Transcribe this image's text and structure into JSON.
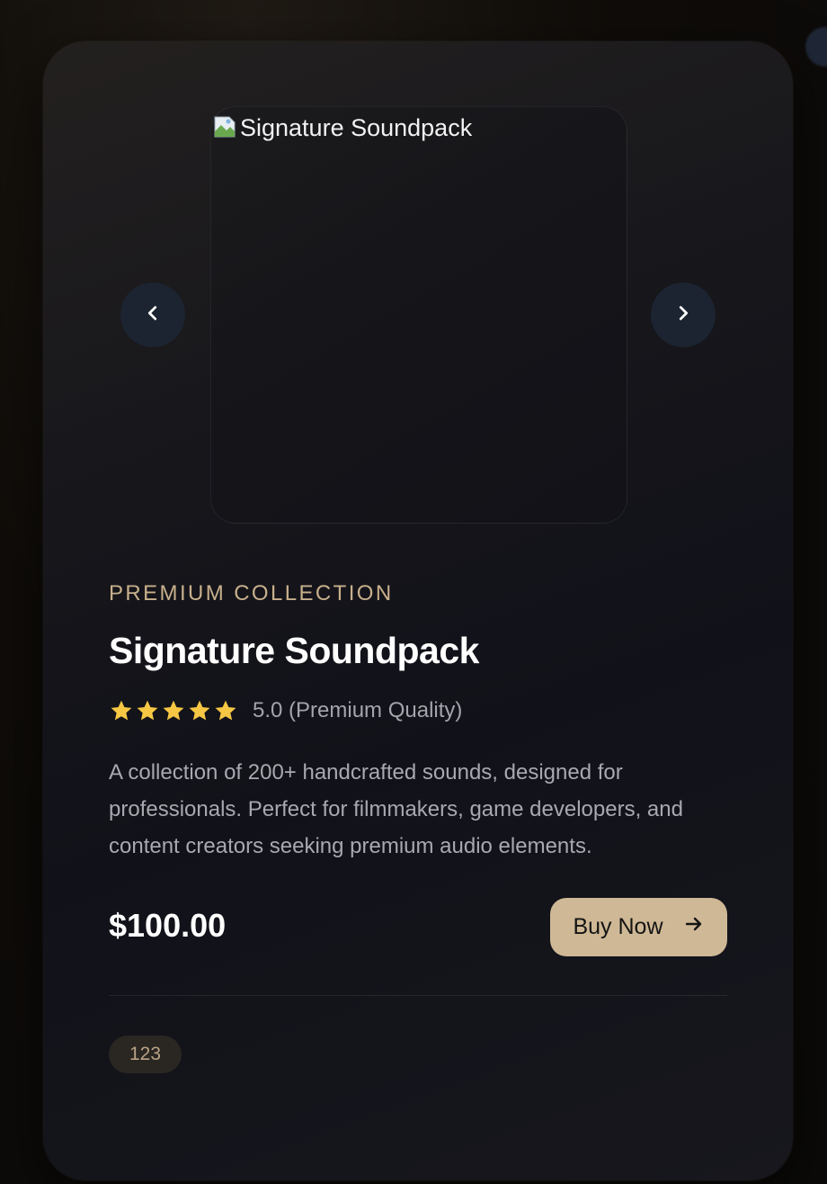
{
  "product": {
    "image_alt": "Signature Soundpack",
    "eyebrow": "PREMIUM COLLECTION",
    "title": "Signature Soundpack",
    "rating": {
      "stars": 5,
      "max_stars": 5,
      "text": "5.0 (Premium Quality)"
    },
    "description": "A collection of 200+ handcrafted sounds, designed for professionals. Perfect for filmmakers, game developers, and content creators seeking premium audio elements.",
    "price": "$100.00",
    "buy_label": "Buy Now",
    "tag": "123"
  },
  "carousel": {
    "prev_icon": "chevron-left-icon",
    "next_icon": "chevron-right-icon"
  },
  "colors": {
    "accent": "#cfb895",
    "eyebrow": "#c8b08c",
    "star": "#f5c744",
    "nav_button": "#1c2431"
  }
}
